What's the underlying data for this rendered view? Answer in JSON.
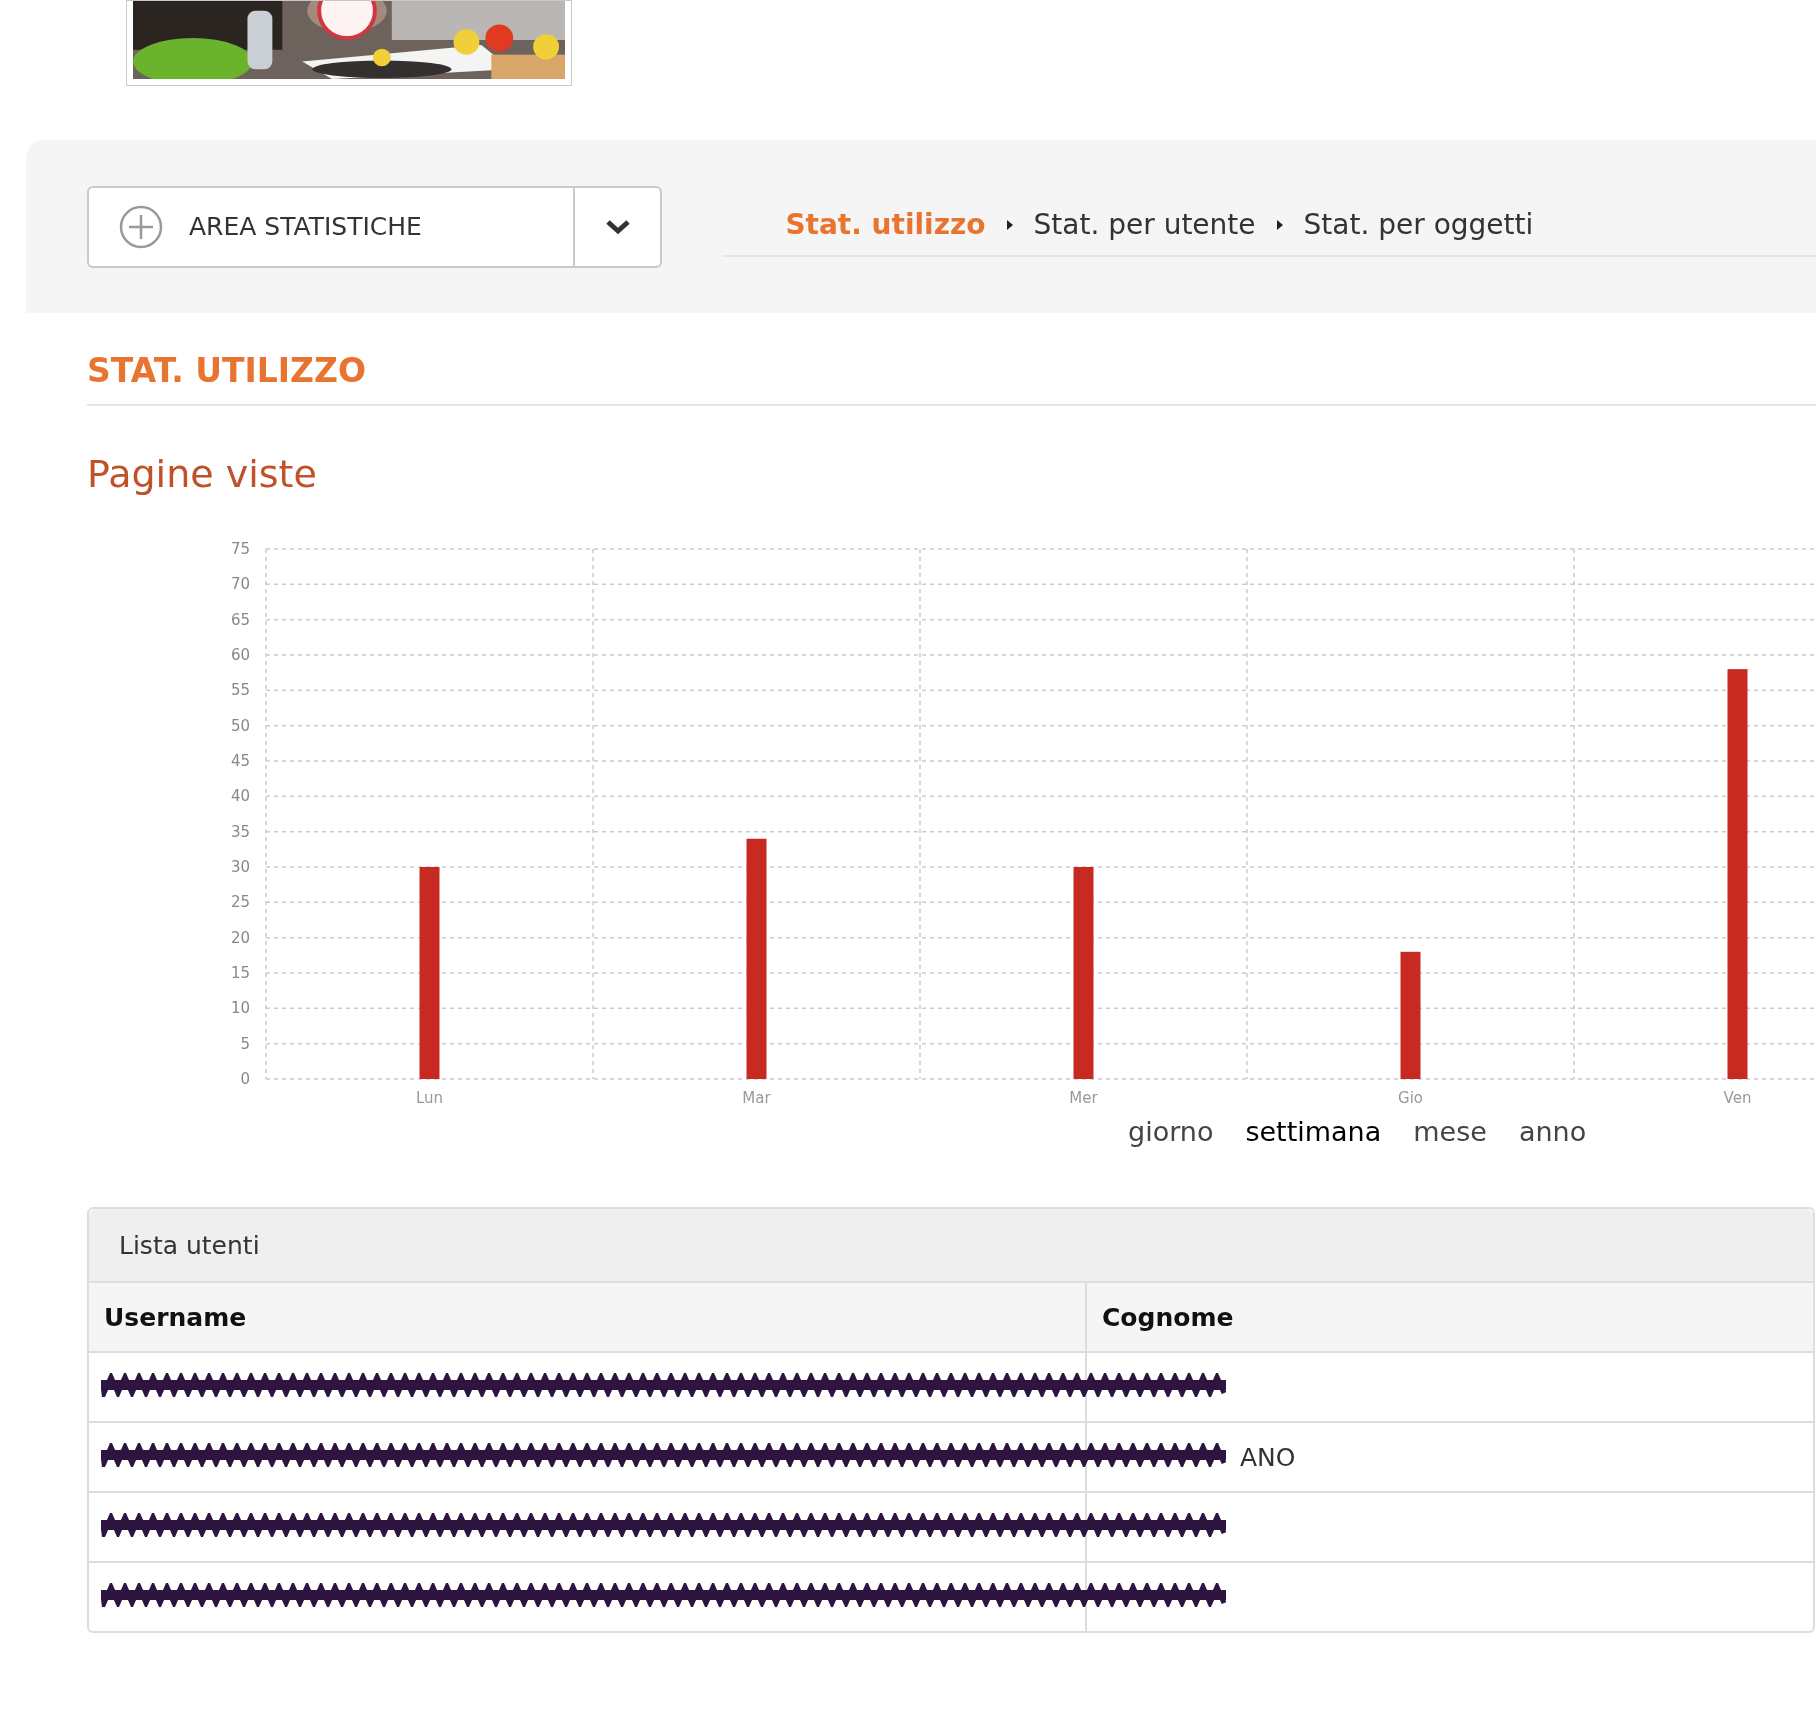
{
  "area_menu": {
    "label": "AREA STATISTICHE"
  },
  "breadcrumbs": [
    {
      "label": "Stat. utilizzo",
      "selected": true
    },
    {
      "label": "Stat. per utente",
      "selected": false
    },
    {
      "label": "Stat. per oggetti",
      "selected": false
    }
  ],
  "section_title": "STAT. UTILIZZO",
  "chart_title": "Pagine viste",
  "chart": {
    "chart_data": {
      "type": "bar",
      "categories": [
        "Lun",
        "Mar",
        "Mer",
        "Gio",
        "Ven"
      ],
      "series": [
        {
          "color": "#c62a20",
          "values": [
            30,
            34,
            30,
            18,
            58
          ]
        }
      ],
      "grid": true,
      "ylim": [
        0,
        75
      ],
      "yticks": [
        0,
        5,
        10,
        15,
        20,
        25,
        30,
        35,
        40,
        45,
        50,
        55,
        60,
        65,
        70,
        75
      ]
    }
  },
  "periods": [
    {
      "label": "giorno",
      "selected": false
    },
    {
      "label": "settimana",
      "selected": true
    },
    {
      "label": "mese",
      "selected": false
    },
    {
      "label": "anno",
      "selected": false
    }
  ],
  "users_panel": {
    "title": "Lista utenti",
    "columns": [
      "Username",
      "Cognome"
    ],
    "rows": [
      {
        "redacted": true
      },
      {
        "redacted": true,
        "cognome": "ANO"
      },
      {
        "redacted": true
      },
      {
        "redacted": true
      }
    ]
  }
}
